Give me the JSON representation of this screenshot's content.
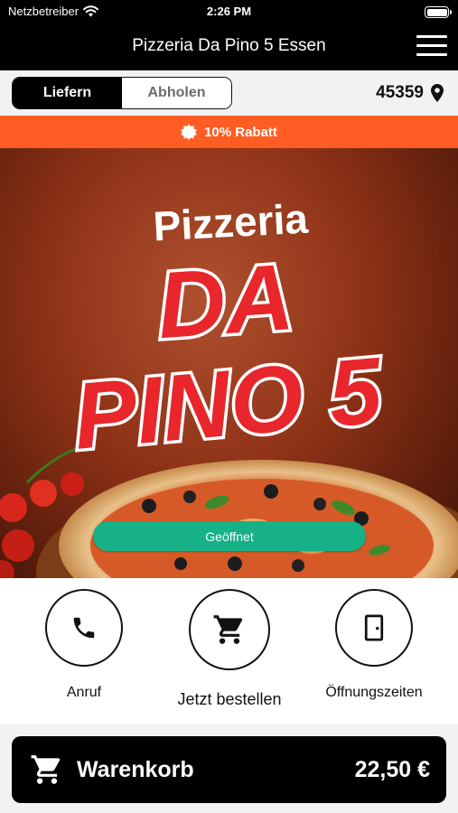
{
  "status_bar": {
    "carrier": "Netzbetreiber",
    "time": "2:26 PM",
    "wifi_icon": "wifi-icon",
    "battery_icon": "battery-icon"
  },
  "nav": {
    "title": "Pizzeria Da Pino 5 Essen",
    "menu_icon": "hamburger-menu-icon"
  },
  "order_mode": {
    "options": [
      "Liefern",
      "Abholen"
    ],
    "selected": "Liefern"
  },
  "location": {
    "zip": "45359",
    "icon": "map-pin-icon"
  },
  "promo": {
    "text": "10% Rabatt",
    "icon": "discount-badge-icon"
  },
  "hero": {
    "logo_line1": "Pizzeria",
    "logo_line2": "DA",
    "logo_line3": "PINO 5",
    "status": "Geöffnet"
  },
  "actions": [
    {
      "label": "Anruf",
      "icon": "phone-icon"
    },
    {
      "label": "Jetzt bestellen",
      "icon": "shopping-cart-icon"
    },
    {
      "label": "Öffnungszeiten",
      "icon": "door-icon"
    }
  ],
  "cart": {
    "label": "Warenkorb",
    "total": "22,50 €",
    "icon": "shopping-cart-icon"
  },
  "colors": {
    "promo_orange": "#ff5d23",
    "open_green": "#16b187",
    "logo_red": "#e8262b"
  }
}
